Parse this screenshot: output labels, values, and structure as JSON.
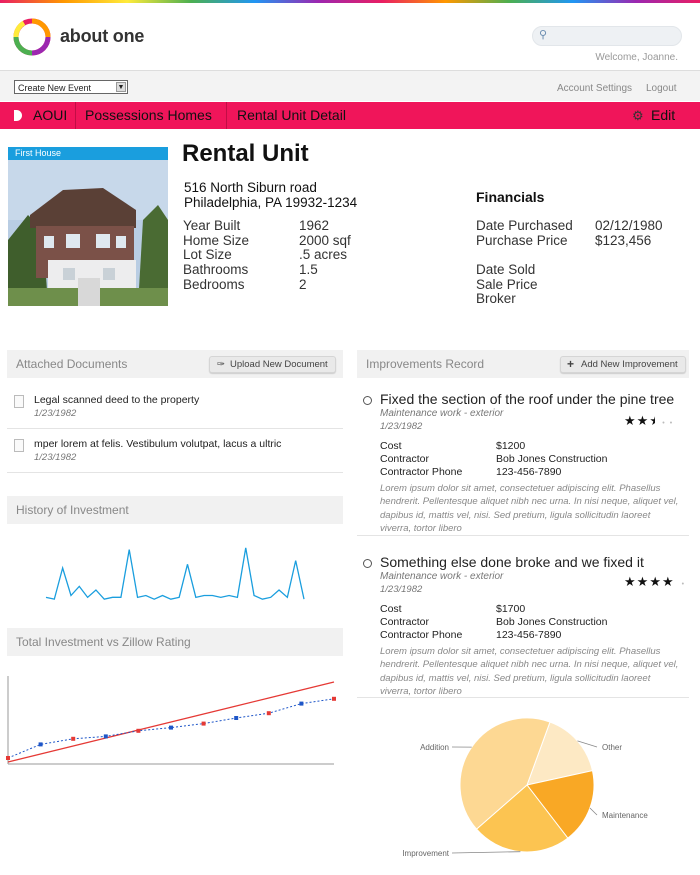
{
  "header": {
    "brand": "about one",
    "search": {
      "placeholder": ""
    },
    "welcome": "Welcome, Joanne."
  },
  "subbar": {
    "create_event": "Create New Event",
    "account_settings": "Account Settings",
    "logout": "Logout"
  },
  "nav": {
    "items": [
      "AOUI",
      "Possessions Homes",
      "Rental Unit Detail"
    ],
    "edit": "Edit"
  },
  "property": {
    "photo_label": "First House",
    "title": "Rental Unit",
    "address_line1": "516 North Siburn road",
    "address_line2": "Philadelphia, PA 19932-1234",
    "details": [
      {
        "label": "Year Built",
        "value": "1962"
      },
      {
        "label": "Home Size",
        "value": "2000 sqf"
      },
      {
        "label": "Lot Size",
        "value": ".5 acres"
      },
      {
        "label": "Bathrooms",
        "value": "1.5"
      },
      {
        "label": "Bedrooms",
        "value": "2"
      }
    ],
    "financials": {
      "title": "Financials",
      "rows": [
        {
          "label": "Date Purchased",
          "value": "02/12/1980"
        },
        {
          "label": "Purchase Price",
          "value": "$123,456"
        },
        {
          "label": "Date Sold",
          "value": ""
        },
        {
          "label": "Sale Price",
          "value": ""
        },
        {
          "label": "Broker",
          "value": ""
        }
      ]
    }
  },
  "documents": {
    "title": "Attached Documents",
    "upload_label": "Upload New Document",
    "items": [
      {
        "title": "Legal scanned deed to the property",
        "date": "1/23/1982"
      },
      {
        "title": "mper lorem at felis. Vestibulum volutpat, lacus a ultric",
        "date": "1/23/1982"
      }
    ]
  },
  "history": {
    "title": "History of Investment",
    "chart_data": {
      "type": "line",
      "series": [
        {
          "values": [
            2,
            1,
            18,
            3,
            8,
            2,
            6,
            1,
            2,
            2,
            28,
            2,
            3,
            1,
            3,
            1,
            2,
            20,
            2,
            3,
            3,
            2,
            3,
            2,
            29,
            3,
            1,
            2,
            6,
            2,
            22,
            1
          ]
        }
      ]
    }
  },
  "zillow": {
    "title": "Total Investment vs Zillow Rating",
    "chart_data": {
      "type": "line",
      "series": [
        {
          "values": [
            0,
            1,
            2,
            3,
            4,
            5,
            6,
            7,
            8,
            9,
            10
          ]
        },
        {
          "values": [
            0.5,
            2.2,
            2.9,
            3.2,
            3.9,
            4.3,
            4.8,
            5.5,
            6.1,
            7.3,
            7.9
          ]
        }
      ]
    }
  },
  "improvements": {
    "title": "Improvements Record",
    "add_label": "Add New Improvement",
    "items": [
      {
        "title": "Fixed the section of the roof under the pine tree",
        "category": "Maintenance work - exterior",
        "date": "1/23/1982",
        "cost_label": "Cost",
        "cost": "$1200",
        "contractor_label": "Contractor",
        "contractor": "Bob Jones Construction",
        "phone_label": "Contractor Phone",
        "phone": "123-456-7890",
        "notes": "Lorem ipsum dolor sit amet, consectetuer adipiscing elit. Phasellus hendrerit. Pellentesque aliquet nibh nec urna. In nisi neque, aliquet vel, dapibus id, mattis vel, nisi. Sed pretium, ligula sollicitudin laoreet viverra, tortor libero",
        "rating": 2.5
      },
      {
        "title": "Something else done broke and we fixed it",
        "category": "Maintenance work - exterior",
        "date": "1/23/1982",
        "cost_label": "Cost",
        "cost": "$1700",
        "contractor_label": "Contractor",
        "contractor": "Bob Jones Construction",
        "phone_label": "Contractor Phone",
        "phone": "123-456-7890",
        "notes": "Lorem ipsum dolor sit amet, consectetuer adipiscing elit. Phasellus hendrerit. Pellentesque aliquet nibh nec urna. In nisi neque, aliquet vel, dapibus id, mattis vel, nisi. Sed pretium, ligula sollicitudin laoreet viverra, tortor libero",
        "rating": 4
      }
    ]
  },
  "pie": {
    "chart_data": {
      "type": "pie",
      "slices": [
        {
          "label": "Other",
          "value": 16,
          "color": "#fde9c4"
        },
        {
          "label": "Maintenance",
          "value": 18,
          "color": "#f9a825"
        },
        {
          "label": "Improvement",
          "value": 24,
          "color": "#fcc451"
        },
        {
          "label": "Addition",
          "value": 42,
          "color": "#fdd893"
        }
      ]
    }
  },
  "colors": {
    "brand_pink": "#f0155a",
    "accent_blue": "#1a9ede",
    "line_red": "#e53935",
    "line_blue": "#1e56c8"
  }
}
